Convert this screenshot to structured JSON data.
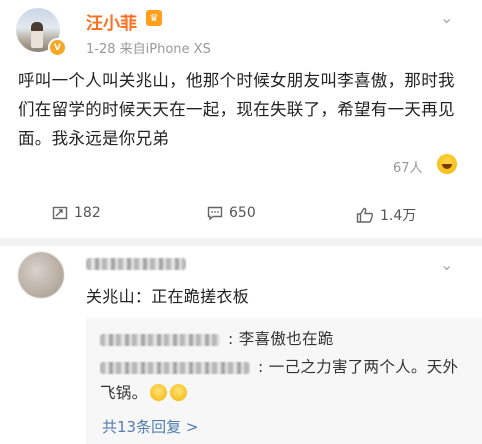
{
  "post": {
    "author": "汪小菲",
    "verified_badge": "V",
    "date": "1-28",
    "source": "来自iPhone XS",
    "meta_text": "1-28  来自iPhone XS",
    "content": "呼叫一个人叫关兆山，他那个时候女朋友叫李喜傲，那时我们在留学的时候天天在一起，现在失联了，希望有一天再见面。我永远是你兄弟",
    "reactions_count": "67人",
    "more_icon": "chevron-down-icon"
  },
  "actions": {
    "repost_count": "182",
    "comment_count": "650",
    "like_count": "1.4万"
  },
  "comment": {
    "text": "关兆山：正在跪搓衣板",
    "replies": [
      {
        "text": ": 李喜傲也在跪"
      },
      {
        "text": ": 一己之力害了两个人。天外飞锅。"
      }
    ],
    "more_replies": "共13条回复 >"
  },
  "colors": {
    "username": "#ff6d1f",
    "link": "#507daf",
    "meta": "#999999"
  }
}
